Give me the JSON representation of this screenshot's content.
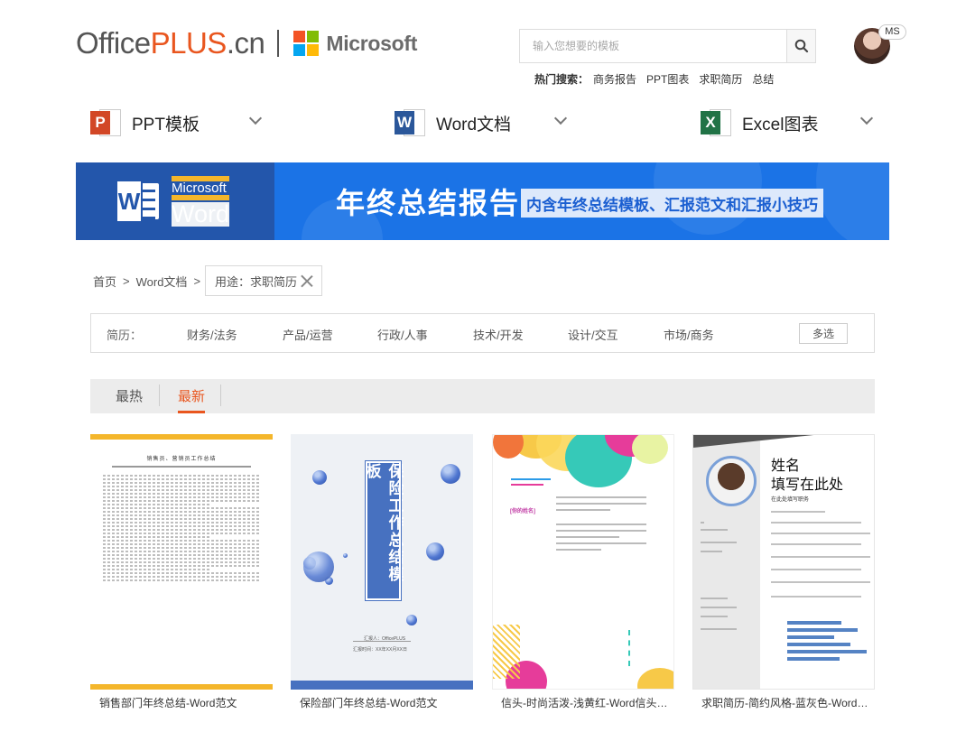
{
  "brand": {
    "office": "Office",
    "plus": "PLUS",
    "cn": ".cn",
    "microsoft": "Microsoft"
  },
  "colors": {
    "accent": "#e9561f",
    "banner_blue": "#1b73e6",
    "banner_dark": "#2356ab",
    "ms_red": "#f35325",
    "ms_green": "#81bc06",
    "ms_blue": "#05a6f0",
    "ms_yellow": "#ffba08"
  },
  "search": {
    "placeholder": "输入您想要的模板"
  },
  "hot_search": {
    "label": "热门搜索：",
    "items": [
      "商务报告",
      "PPT图表",
      "求职简历",
      "总结"
    ]
  },
  "user": {
    "badge": "MS"
  },
  "categories": [
    {
      "icon": "powerpoint-icon",
      "letter": "P",
      "label": "PPT模板"
    },
    {
      "icon": "word-icon",
      "letter": "W",
      "label": "Word文档"
    },
    {
      "icon": "excel-icon",
      "letter": "X",
      "label": "Excel图表"
    }
  ],
  "banner": {
    "ms_line1": "Microsoft",
    "ms_line2": "Word",
    "title": "年终总结报告",
    "subtitle": "内含年终总结模板、汇报范文和汇报小技巧"
  },
  "breadcrumb": {
    "home": "首页",
    "section": "Word文档",
    "sep": ">"
  },
  "active_filter": {
    "label": "用途：求职简历"
  },
  "filter_bar": {
    "label": "简历：",
    "options": [
      "财务/法务",
      "产品/运营",
      "行政/人事",
      "技术/开发",
      "设计/交互",
      "市场/商务"
    ],
    "multi": "多选"
  },
  "sort_tabs": {
    "hot": "最热",
    "new": "最新",
    "active": "new"
  },
  "cards": [
    {
      "title": "销售部门年终总结-Word范文",
      "thumb_heading": "销售员、营销员工作总结"
    },
    {
      "title": "保险部门年终总结-Word范文",
      "thumb_heading": "保险工作总结模板",
      "thumb_info1": "汇报人：OfficePLUS",
      "thumb_info2": "汇报时间：XX年XX月XX日"
    },
    {
      "title": "信头-时尚活泼-浅黄红-Word信头模板",
      "thumb_name": "[你的姓名]"
    },
    {
      "title": "求职简历-简约风格-蓝灰色-Word简历",
      "thumb_name": "姓名\n填写在此处",
      "thumb_sub": "在此处填写职务"
    }
  ]
}
